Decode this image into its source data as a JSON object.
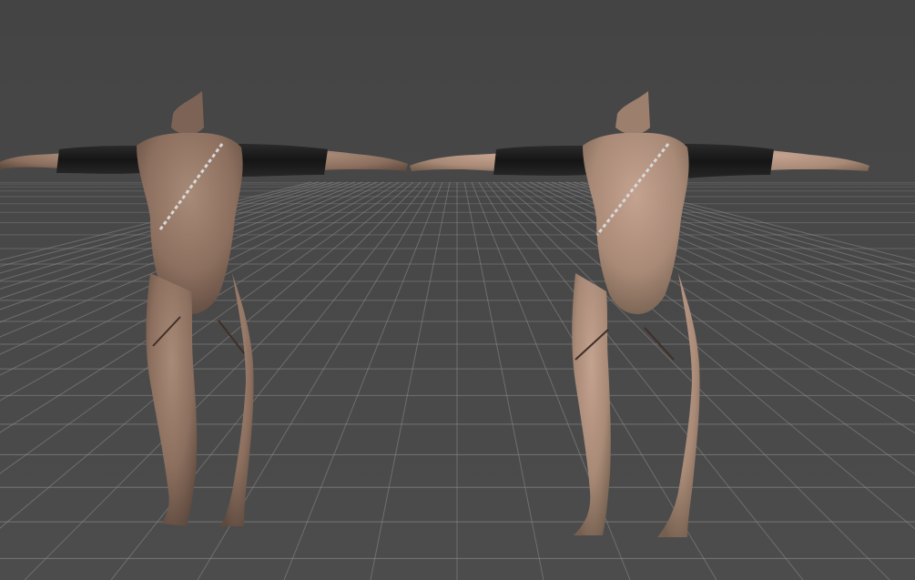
{
  "viewport": {
    "background_color": "#474747",
    "grid_color": "#8c8c8c",
    "models": [
      {
        "variant": "darker-skin",
        "skin_color": "#9a7d6b",
        "sleeve_color": "#1c1c1c"
      },
      {
        "variant": "lighter-skin",
        "skin_color": "#b4927f",
        "sleeve_color": "#1c1c1c"
      }
    ]
  }
}
